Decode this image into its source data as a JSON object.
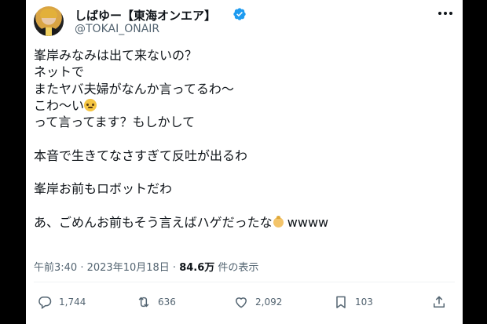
{
  "tweet": {
    "display_name": "しばゆー【東海オンエア】",
    "handle": "@TOKAI_ONAIR",
    "lines": [
      "峯岸みなみは出て来ないの？",
      "ネットで",
      "またヤバ夫婦がなんか言ってるわ〜",
      "こわ〜い",
      "って言ってます？もしかして",
      "",
      "本音で生きてなさすぎて反吐が出るわ",
      "",
      "峯岸お前もロボットだわ",
      "",
      "あ、ごめんお前もそう言えばハゲだったな",
      "wwww"
    ],
    "time": "午前3:40",
    "separator": " · ",
    "date": "2023年10月18日",
    "views_count": "84.6万",
    "views_label": " 件の表示"
  },
  "actions": {
    "replies": "1,744",
    "retweets": "636",
    "likes": "2,092",
    "bookmarks": "103"
  },
  "icons": [
    "verified-badge-icon",
    "more-icon",
    "reply-icon",
    "retweet-icon",
    "like-icon",
    "bookmark-icon",
    "share-icon",
    "pleading-face-emoji",
    "baby-emoji"
  ],
  "colors": {
    "verified": "#1d9bf0",
    "text": "#0f1419",
    "muted": "#536471",
    "background": "#000000"
  }
}
